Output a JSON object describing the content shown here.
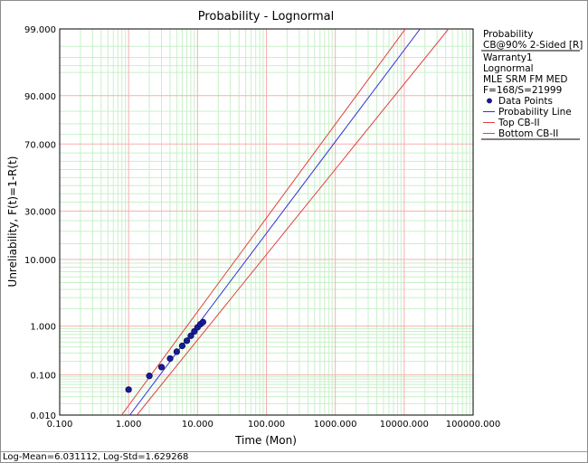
{
  "chart_data": {
    "type": "scatter",
    "title": "Probability - Lognormal",
    "xlabel": "Time (Mon)",
    "ylabel": "Unreliability, F(t)=1-R(t)",
    "x_scale": "log",
    "y_scale": "lognormal-probability",
    "xlim": [
      0.1,
      100000
    ],
    "ylim": [
      0.01,
      99
    ],
    "x_ticks": [
      0.1,
      1,
      10,
      100,
      1000,
      10000,
      100000
    ],
    "x_tick_labels": [
      "0.100",
      "1.000",
      "10.000",
      "100.000",
      "1000.000",
      "10000.000",
      "100000.000"
    ],
    "y_ticks": [
      0.01,
      0.1,
      1,
      10,
      30,
      70,
      90,
      99
    ],
    "y_tick_labels": [
      "0.010",
      "0.100",
      "1.000",
      "10.000",
      "30.000",
      "70.000",
      "90.000",
      "99.000"
    ],
    "grid": true,
    "legend_position": "right",
    "legend_header": {
      "line1": "Probability",
      "line2": "CB@90% 2-Sided [R]",
      "info": [
        "Warranty1",
        "Lognormal",
        "MLE SRM FM MED",
        "F=168/S=21999"
      ]
    },
    "series": [
      {
        "name": "Data Points",
        "kind": "points",
        "color": "#1a1a99",
        "x": [
          1,
          2,
          3,
          4,
          5,
          6,
          7,
          8,
          9,
          10,
          11,
          12
        ],
        "y": [
          0.045,
          0.095,
          0.15,
          0.23,
          0.32,
          0.42,
          0.53,
          0.66,
          0.8,
          0.95,
          1.08,
          1.18
        ]
      },
      {
        "name": "Probability Line",
        "kind": "line",
        "color": "#3030d8",
        "x": [
          1.04,
          17000
        ],
        "y": [
          0.01,
          99
        ]
      },
      {
        "name": "Top CB-II",
        "kind": "line",
        "color": "#e04040",
        "x": [
          0.79,
          10400
        ],
        "y": [
          0.01,
          99
        ]
      },
      {
        "name": "Bottom CB-II",
        "kind": "line",
        "color": "#e04040",
        "x": [
          1.32,
          44000
        ],
        "y": [
          0.01,
          99
        ]
      }
    ]
  },
  "status": {
    "text": "Log-Mean=6.031112, Log-Std=1.629268"
  }
}
